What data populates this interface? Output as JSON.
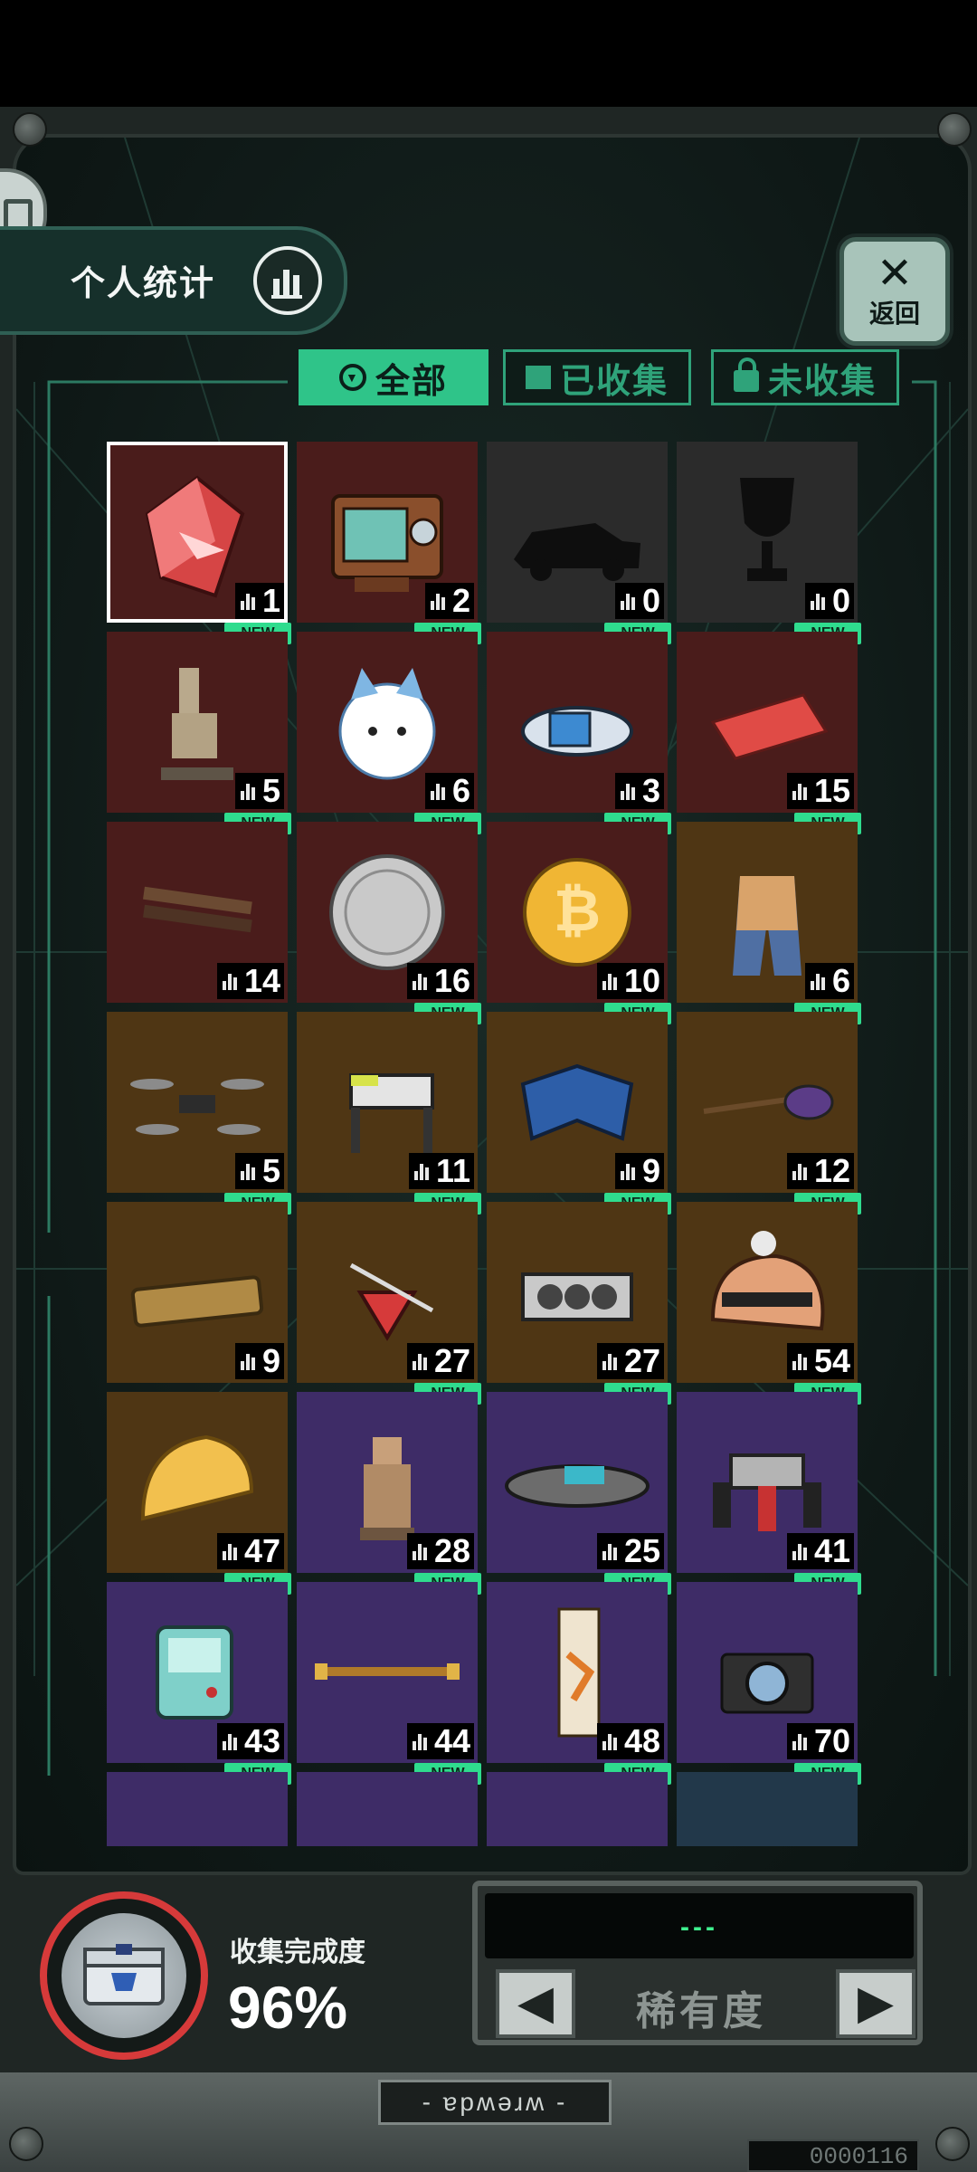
{
  "header": {
    "stats_label": "个人统计",
    "back_icon": "x-icon",
    "back_label": "返回"
  },
  "tabs": [
    {
      "label": "全部",
      "icon": "filter-icon",
      "active": true
    },
    {
      "label": "已收集",
      "icon": "box-icon",
      "active": false
    },
    {
      "label": "未收集",
      "icon": "lock-icon",
      "active": false
    }
  ],
  "colors": {
    "accent": "#2fc489",
    "new_badge": "#2fdc8e",
    "tier_red": "#4a1c1b",
    "tier_gold": "#4f3614",
    "tier_purple": "#3e2c67",
    "tier_grey": "#2b2b2b",
    "progress_ring": "#d63a3a"
  },
  "items": [
    {
      "id": "crystal-shard",
      "count": "1",
      "tier": "red",
      "selected": true,
      "new": true
    },
    {
      "id": "retro-tv",
      "count": "2",
      "tier": "red",
      "new": true
    },
    {
      "id": "locked-car-silhouette",
      "count": "0",
      "tier": "grey",
      "new": true
    },
    {
      "id": "locked-trophy-silhouette",
      "count": "0",
      "tier": "grey",
      "new": true
    },
    {
      "id": "horse-statue",
      "count": "5",
      "tier": "red",
      "new": true
    },
    {
      "id": "cat-plush",
      "count": "6",
      "tier": "red",
      "new": true
    },
    {
      "id": "robot-ship",
      "count": "3",
      "tier": "red",
      "new": true
    },
    {
      "id": "meta-card",
      "count": "15",
      "tier": "red",
      "new": true
    },
    {
      "id": "wooden-chopsticks",
      "count": "14",
      "tier": "red",
      "new": false
    },
    {
      "id": "silver-coin",
      "count": "16",
      "tier": "red",
      "new": true
    },
    {
      "id": "bitcoin",
      "count": "10",
      "tier": "red",
      "new": true
    },
    {
      "id": "overalls",
      "count": "6",
      "tier": "gold",
      "new": true
    },
    {
      "id": "drone",
      "count": "5",
      "tier": "gold",
      "new": true
    },
    {
      "id": "robot-dog",
      "count": "11",
      "tier": "gold",
      "new": true
    },
    {
      "id": "foldable-screen",
      "count": "9",
      "tier": "gold",
      "new": true
    },
    {
      "id": "electric-guitar",
      "count": "12",
      "tier": "gold",
      "new": true
    },
    {
      "id": "phone",
      "count": "9",
      "tier": "gold",
      "new": false
    },
    {
      "id": "spinning-top",
      "count": "27",
      "tier": "gold",
      "new": true
    },
    {
      "id": "graphics-card",
      "count": "27",
      "tier": "gold",
      "new": true
    },
    {
      "id": "ski-helmet",
      "count": "54",
      "tier": "gold",
      "new": true
    },
    {
      "id": "cheese-wedge",
      "count": "47",
      "tier": "gold",
      "new": true
    },
    {
      "id": "terracotta-warrior",
      "count": "28",
      "tier": "purple",
      "new": true
    },
    {
      "id": "hoverboard",
      "count": "25",
      "tier": "purple",
      "new": true
    },
    {
      "id": "dancing-pallbearers",
      "count": "41",
      "tier": "purple",
      "new": true
    },
    {
      "id": "bmo-console",
      "count": "43",
      "tier": "purple",
      "new": true
    },
    {
      "id": "golden-staff",
      "count": "44",
      "tier": "purple",
      "new": true
    },
    {
      "id": "tiger-scroll",
      "count": "48",
      "tier": "purple",
      "new": true
    },
    {
      "id": "camera",
      "count": "70",
      "tier": "purple",
      "new": true
    },
    {
      "id": "partial-item-1",
      "count": "",
      "tier": "purple"
    },
    {
      "id": "partial-item-2",
      "count": "",
      "tier": "purple"
    },
    {
      "id": "partial-item-3",
      "count": "",
      "tier": "purple"
    },
    {
      "id": "basketball",
      "count": "",
      "tier": "blue"
    }
  ],
  "new_badge_label": "NEW",
  "footer": {
    "progress_label": "收集完成度",
    "progress_value": "96%",
    "progress_fraction": 0.96,
    "sort_display": "---",
    "sort_label": "稀有度",
    "prev_icon": "arrow-left-icon",
    "next_icon": "arrow-right-icon",
    "nameplate": "- ɐpʍǝɹʍ -",
    "counter": "0000116"
  }
}
